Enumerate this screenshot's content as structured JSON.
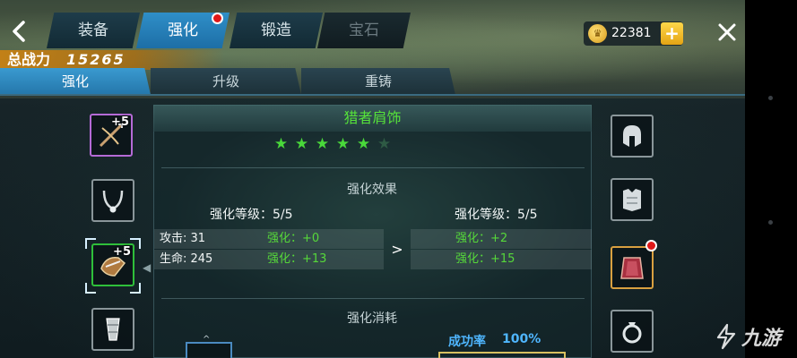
{
  "top_bar": {
    "tabs": [
      {
        "label": "装备",
        "state": "normal"
      },
      {
        "label": "强化",
        "state": "active",
        "has_notification": true
      },
      {
        "label": "锻造",
        "state": "normal"
      },
      {
        "label": "宝石",
        "state": "disabled"
      }
    ],
    "currency": {
      "value": "22381",
      "icon": "gold-coin-icon",
      "coin_glyph": "♛",
      "plus_label": "+"
    }
  },
  "power": {
    "label": "总战力",
    "value": "15265"
  },
  "sub_tabs": [
    {
      "label": "强化",
      "active": true
    },
    {
      "label": "升级",
      "active": false
    },
    {
      "label": "重铸",
      "active": false
    }
  ],
  "left_slots": [
    {
      "item": "crossbow",
      "rarity": "purple",
      "plus": "+5"
    },
    {
      "item": "necklace",
      "rarity": "grey",
      "plus": ""
    },
    {
      "item": "shoulder-guard",
      "rarity": "green",
      "plus": "+5",
      "selected": true
    },
    {
      "item": "bracer",
      "rarity": "grey",
      "plus": ""
    }
  ],
  "right_slots": [
    {
      "item": "helmet",
      "rarity": "grey"
    },
    {
      "item": "chest-armor",
      "rarity": "grey"
    },
    {
      "item": "cape",
      "rarity": "gold",
      "has_notification": true
    },
    {
      "item": "ring",
      "rarity": "grey"
    }
  ],
  "item": {
    "name": "猎者肩饰",
    "stars_filled": 5,
    "stars_total": 6
  },
  "effect": {
    "section_title": "强化效果",
    "current": {
      "level_label": "强化等级：5/5",
      "stats": [
        {
          "name": "攻击: 31",
          "bonus": "强化：+0"
        },
        {
          "name": "生命: 245",
          "bonus": "强化：+13"
        }
      ]
    },
    "next": {
      "level_label": "强化等级：5/5",
      "stats": [
        {
          "bonus": "强化：+2"
        },
        {
          "bonus": "强化：+15"
        }
      ]
    },
    "arrow": ">"
  },
  "cost": {
    "section_title": "强化消耗",
    "success_label": "成功率",
    "success_value": "100%"
  },
  "watermark": {
    "text": "九游"
  },
  "colors": {
    "tab_active": "#2f8fc8",
    "item_name": "#56e23a",
    "bonus_green": "#56d83a",
    "success_blue": "#4fb6ff",
    "power_bar": "#c8821a",
    "notification_red": "#e01818"
  }
}
